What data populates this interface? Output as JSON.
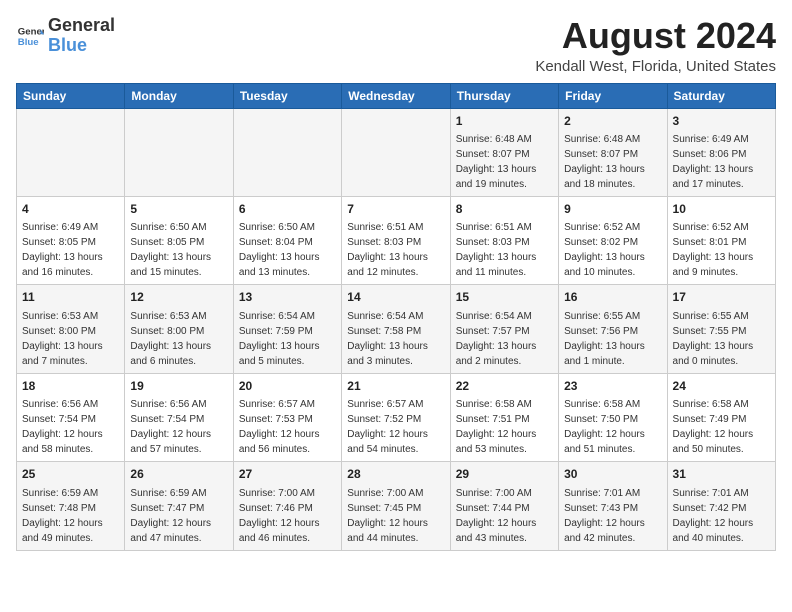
{
  "logo": {
    "text_general": "General",
    "text_blue": "Blue"
  },
  "title": "August 2024",
  "subtitle": "Kendall West, Florida, United States",
  "days_of_week": [
    "Sunday",
    "Monday",
    "Tuesday",
    "Wednesday",
    "Thursday",
    "Friday",
    "Saturday"
  ],
  "weeks": [
    [
      {
        "day": "",
        "info": ""
      },
      {
        "day": "",
        "info": ""
      },
      {
        "day": "",
        "info": ""
      },
      {
        "day": "",
        "info": ""
      },
      {
        "day": "1",
        "info": "Sunrise: 6:48 AM\nSunset: 8:07 PM\nDaylight: 13 hours\nand 19 minutes."
      },
      {
        "day": "2",
        "info": "Sunrise: 6:48 AM\nSunset: 8:07 PM\nDaylight: 13 hours\nand 18 minutes."
      },
      {
        "day": "3",
        "info": "Sunrise: 6:49 AM\nSunset: 8:06 PM\nDaylight: 13 hours\nand 17 minutes."
      }
    ],
    [
      {
        "day": "4",
        "info": "Sunrise: 6:49 AM\nSunset: 8:05 PM\nDaylight: 13 hours\nand 16 minutes."
      },
      {
        "day": "5",
        "info": "Sunrise: 6:50 AM\nSunset: 8:05 PM\nDaylight: 13 hours\nand 15 minutes."
      },
      {
        "day": "6",
        "info": "Sunrise: 6:50 AM\nSunset: 8:04 PM\nDaylight: 13 hours\nand 13 minutes."
      },
      {
        "day": "7",
        "info": "Sunrise: 6:51 AM\nSunset: 8:03 PM\nDaylight: 13 hours\nand 12 minutes."
      },
      {
        "day": "8",
        "info": "Sunrise: 6:51 AM\nSunset: 8:03 PM\nDaylight: 13 hours\nand 11 minutes."
      },
      {
        "day": "9",
        "info": "Sunrise: 6:52 AM\nSunset: 8:02 PM\nDaylight: 13 hours\nand 10 minutes."
      },
      {
        "day": "10",
        "info": "Sunrise: 6:52 AM\nSunset: 8:01 PM\nDaylight: 13 hours\nand 9 minutes."
      }
    ],
    [
      {
        "day": "11",
        "info": "Sunrise: 6:53 AM\nSunset: 8:00 PM\nDaylight: 13 hours\nand 7 minutes."
      },
      {
        "day": "12",
        "info": "Sunrise: 6:53 AM\nSunset: 8:00 PM\nDaylight: 13 hours\nand 6 minutes."
      },
      {
        "day": "13",
        "info": "Sunrise: 6:54 AM\nSunset: 7:59 PM\nDaylight: 13 hours\nand 5 minutes."
      },
      {
        "day": "14",
        "info": "Sunrise: 6:54 AM\nSunset: 7:58 PM\nDaylight: 13 hours\nand 3 minutes."
      },
      {
        "day": "15",
        "info": "Sunrise: 6:54 AM\nSunset: 7:57 PM\nDaylight: 13 hours\nand 2 minutes."
      },
      {
        "day": "16",
        "info": "Sunrise: 6:55 AM\nSunset: 7:56 PM\nDaylight: 13 hours\nand 1 minute."
      },
      {
        "day": "17",
        "info": "Sunrise: 6:55 AM\nSunset: 7:55 PM\nDaylight: 13 hours\nand 0 minutes."
      }
    ],
    [
      {
        "day": "18",
        "info": "Sunrise: 6:56 AM\nSunset: 7:54 PM\nDaylight: 12 hours\nand 58 minutes."
      },
      {
        "day": "19",
        "info": "Sunrise: 6:56 AM\nSunset: 7:54 PM\nDaylight: 12 hours\nand 57 minutes."
      },
      {
        "day": "20",
        "info": "Sunrise: 6:57 AM\nSunset: 7:53 PM\nDaylight: 12 hours\nand 56 minutes."
      },
      {
        "day": "21",
        "info": "Sunrise: 6:57 AM\nSunset: 7:52 PM\nDaylight: 12 hours\nand 54 minutes."
      },
      {
        "day": "22",
        "info": "Sunrise: 6:58 AM\nSunset: 7:51 PM\nDaylight: 12 hours\nand 53 minutes."
      },
      {
        "day": "23",
        "info": "Sunrise: 6:58 AM\nSunset: 7:50 PM\nDaylight: 12 hours\nand 51 minutes."
      },
      {
        "day": "24",
        "info": "Sunrise: 6:58 AM\nSunset: 7:49 PM\nDaylight: 12 hours\nand 50 minutes."
      }
    ],
    [
      {
        "day": "25",
        "info": "Sunrise: 6:59 AM\nSunset: 7:48 PM\nDaylight: 12 hours\nand 49 minutes."
      },
      {
        "day": "26",
        "info": "Sunrise: 6:59 AM\nSunset: 7:47 PM\nDaylight: 12 hours\nand 47 minutes."
      },
      {
        "day": "27",
        "info": "Sunrise: 7:00 AM\nSunset: 7:46 PM\nDaylight: 12 hours\nand 46 minutes."
      },
      {
        "day": "28",
        "info": "Sunrise: 7:00 AM\nSunset: 7:45 PM\nDaylight: 12 hours\nand 44 minutes."
      },
      {
        "day": "29",
        "info": "Sunrise: 7:00 AM\nSunset: 7:44 PM\nDaylight: 12 hours\nand 43 minutes."
      },
      {
        "day": "30",
        "info": "Sunrise: 7:01 AM\nSunset: 7:43 PM\nDaylight: 12 hours\nand 42 minutes."
      },
      {
        "day": "31",
        "info": "Sunrise: 7:01 AM\nSunset: 7:42 PM\nDaylight: 12 hours\nand 40 minutes."
      }
    ]
  ]
}
